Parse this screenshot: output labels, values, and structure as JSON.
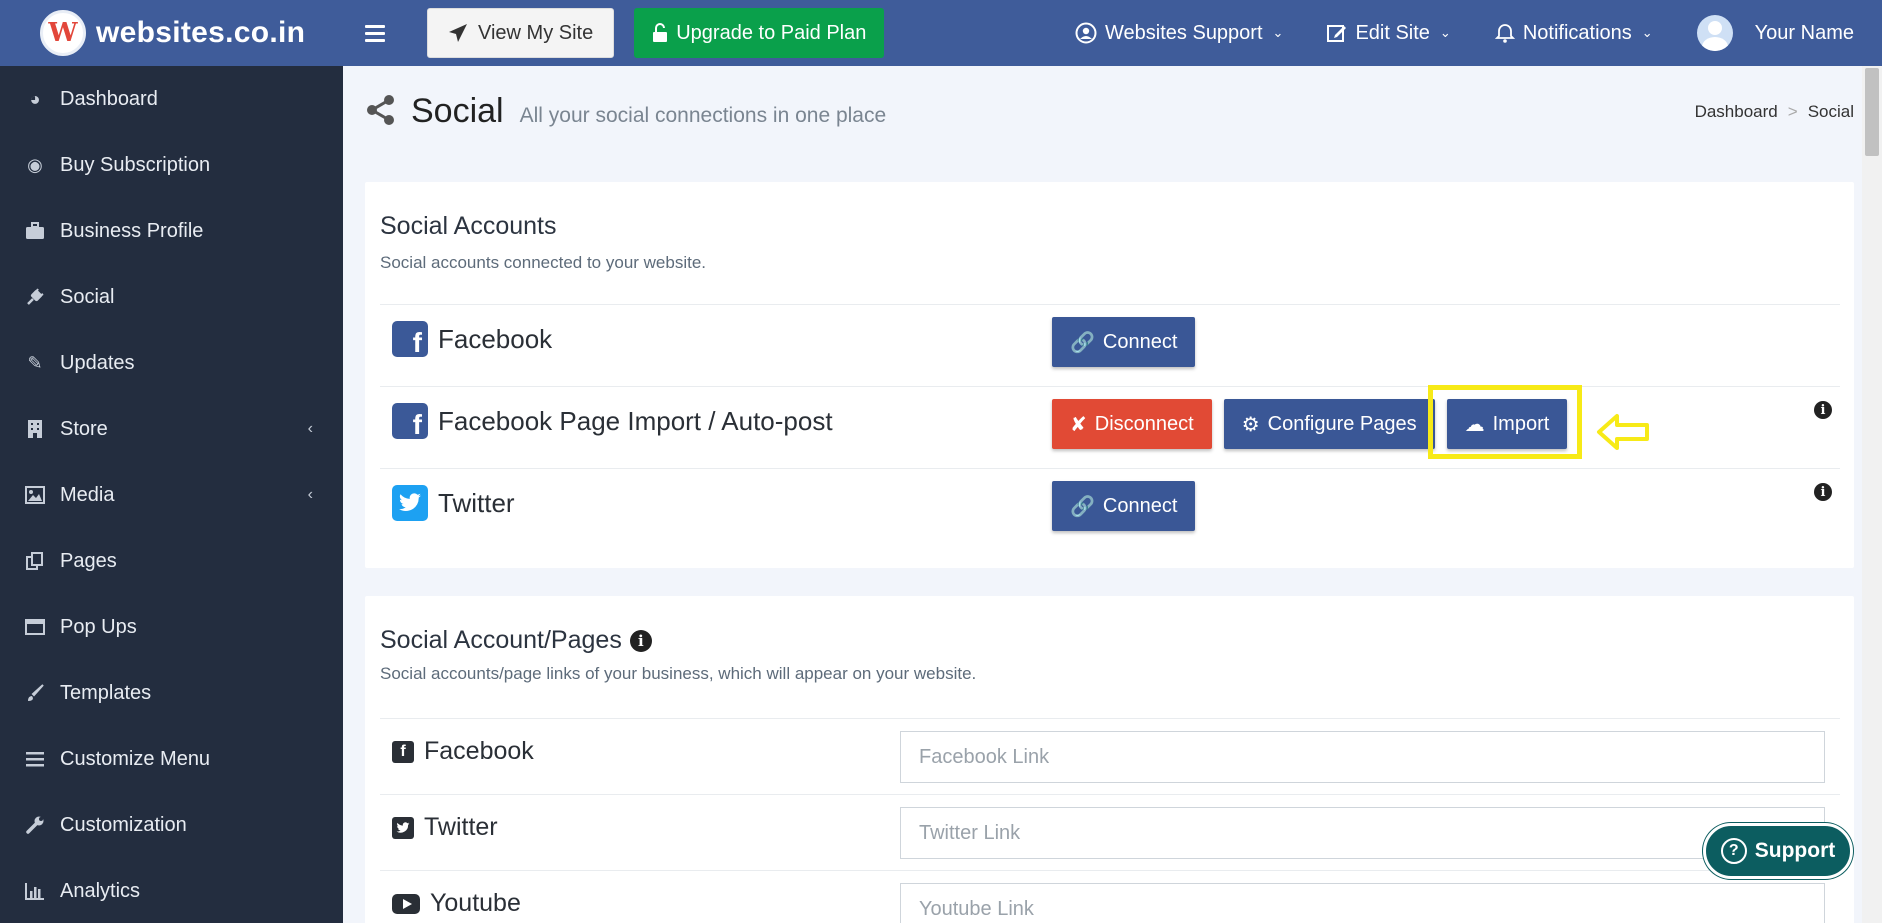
{
  "topbar": {
    "brand": "websites.co.in",
    "logo_letter": "W",
    "view_site": "View My Site",
    "upgrade": "Upgrade to Paid Plan",
    "support_menu": "Websites Support",
    "edit_site": "Edit Site",
    "notifications": "Notifications",
    "user_name": "Your Name"
  },
  "sidebar": {
    "items": [
      {
        "label": "Dashboard",
        "icon": "gauge-icon"
      },
      {
        "label": "Buy Subscription",
        "icon": "dot-circle-icon"
      },
      {
        "label": "Business Profile",
        "icon": "briefcase-icon"
      },
      {
        "label": "Social",
        "icon": "plug-icon"
      },
      {
        "label": "Updates",
        "icon": "pencil-icon"
      },
      {
        "label": "Store",
        "icon": "building-icon",
        "arrow": "‹"
      },
      {
        "label": "Media",
        "icon": "image-icon",
        "arrow": "‹"
      },
      {
        "label": "Pages",
        "icon": "copy-icon"
      },
      {
        "label": "Pop Ups",
        "icon": "window-icon"
      },
      {
        "label": "Templates",
        "icon": "brush-icon"
      },
      {
        "label": "Customize Menu",
        "icon": "bars-icon"
      },
      {
        "label": "Customization",
        "icon": "wrench-icon"
      },
      {
        "label": "Analytics",
        "icon": "bar-chart-icon"
      }
    ]
  },
  "page": {
    "title": "Social",
    "subtitle": "All your social connections in one place",
    "breadcrumb": [
      "Dashboard",
      ">",
      "Social"
    ]
  },
  "social_accounts": {
    "title": "Social Accounts",
    "description": "Social accounts connected to your website.",
    "rows": [
      {
        "label": "Facebook",
        "buttons": [
          "Connect"
        ]
      },
      {
        "label": "Facebook Page Import / Auto-post",
        "buttons": [
          "Disconnect",
          "Configure Pages",
          "Import"
        ]
      },
      {
        "label": "Twitter",
        "buttons": [
          "Connect"
        ]
      }
    ]
  },
  "social_pages": {
    "title": "Social Account/Pages",
    "description": "Social accounts/page links of your business, which will appear on your website.",
    "rows": [
      {
        "label": "Facebook",
        "placeholder": "Facebook Link",
        "value": ""
      },
      {
        "label": "Twitter",
        "placeholder": "Twitter Link",
        "value": ""
      },
      {
        "label": "Youtube",
        "placeholder": "Youtube Link",
        "value": ""
      }
    ]
  },
  "support": {
    "label": "Support"
  },
  "colors": {
    "topbar": "#3f5c9a",
    "sidebar": "#232d3f",
    "primary_button": "#3a5796",
    "danger_button": "#e14a35",
    "success_button": "#0aa04b",
    "highlight": "#f7ea17",
    "support": "#0c5d60"
  }
}
